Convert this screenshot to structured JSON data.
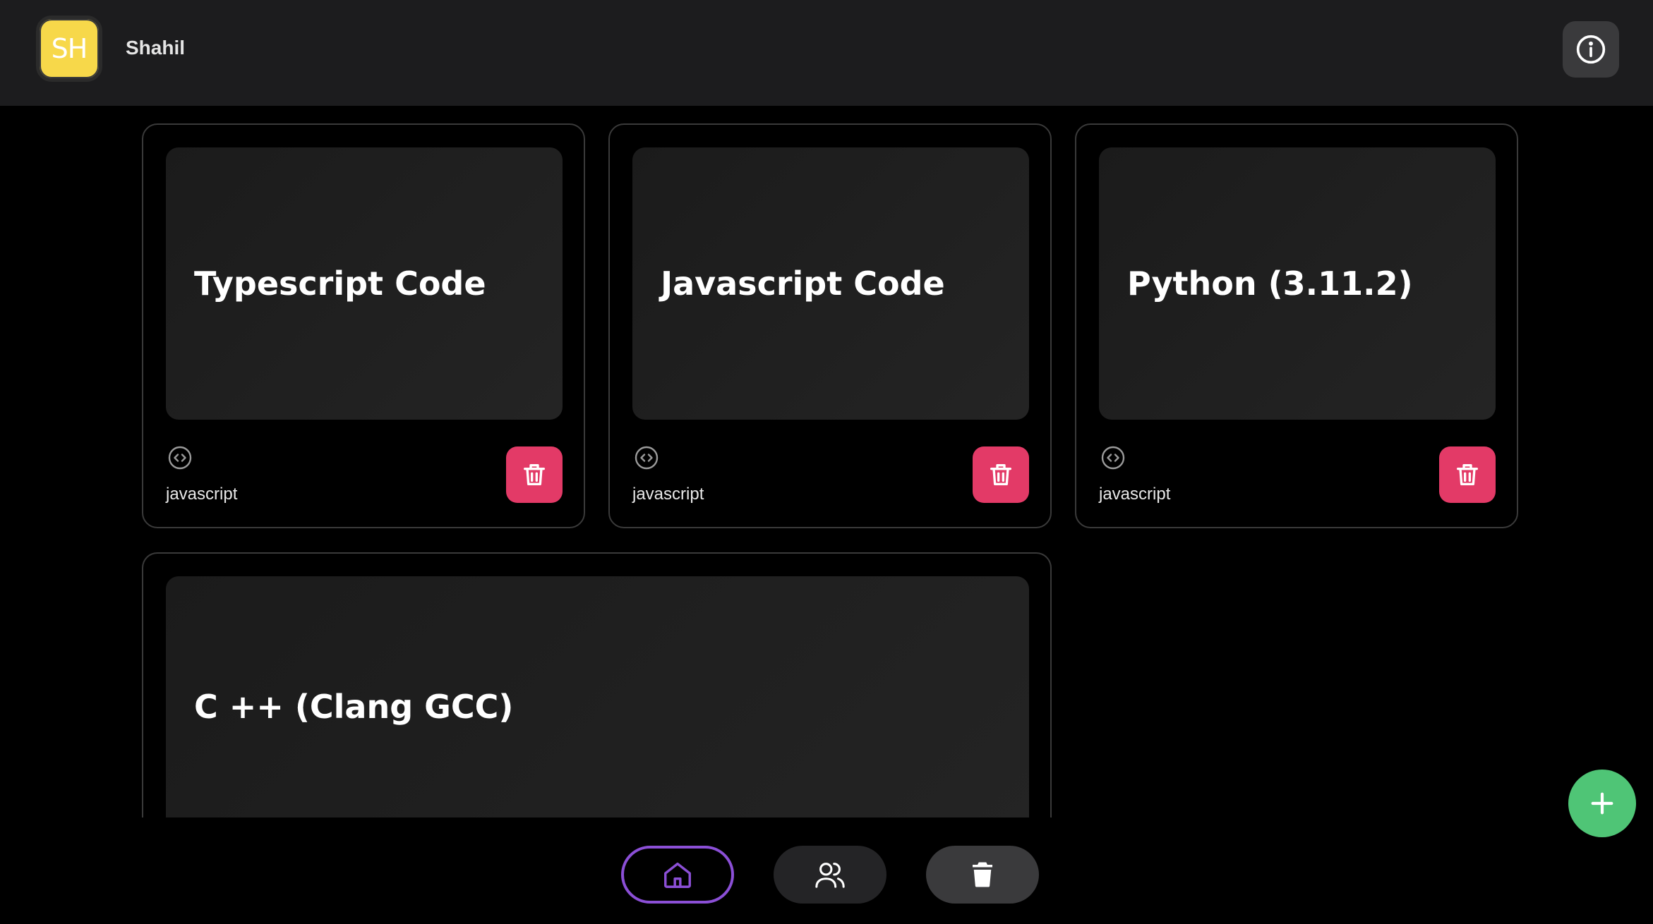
{
  "header": {
    "avatar_initials": "SH",
    "username": "Shahil",
    "info_icon": "info-circle-icon"
  },
  "cards": [
    {
      "title": "Typescript Code",
      "language": "javascript"
    },
    {
      "title": "Javascript Code",
      "language": "javascript"
    },
    {
      "title": "Python (3.11.2)",
      "language": "javascript"
    },
    {
      "title": "C ++ (Clang GCC)",
      "language": ""
    }
  ],
  "icons": {
    "code": "code-circle-icon",
    "delete": "trash-icon",
    "add": "plus-icon",
    "home": "home-icon",
    "users": "users-icon",
    "trash_nav": "trash-filled-icon"
  },
  "colors": {
    "avatar": "#f7d84a",
    "delete": "#e33a67",
    "fab": "#4fc576",
    "active_nav_border": "#8b4fd6",
    "header_bg": "#1c1c1e"
  },
  "bottom_nav": {
    "active": "home"
  }
}
